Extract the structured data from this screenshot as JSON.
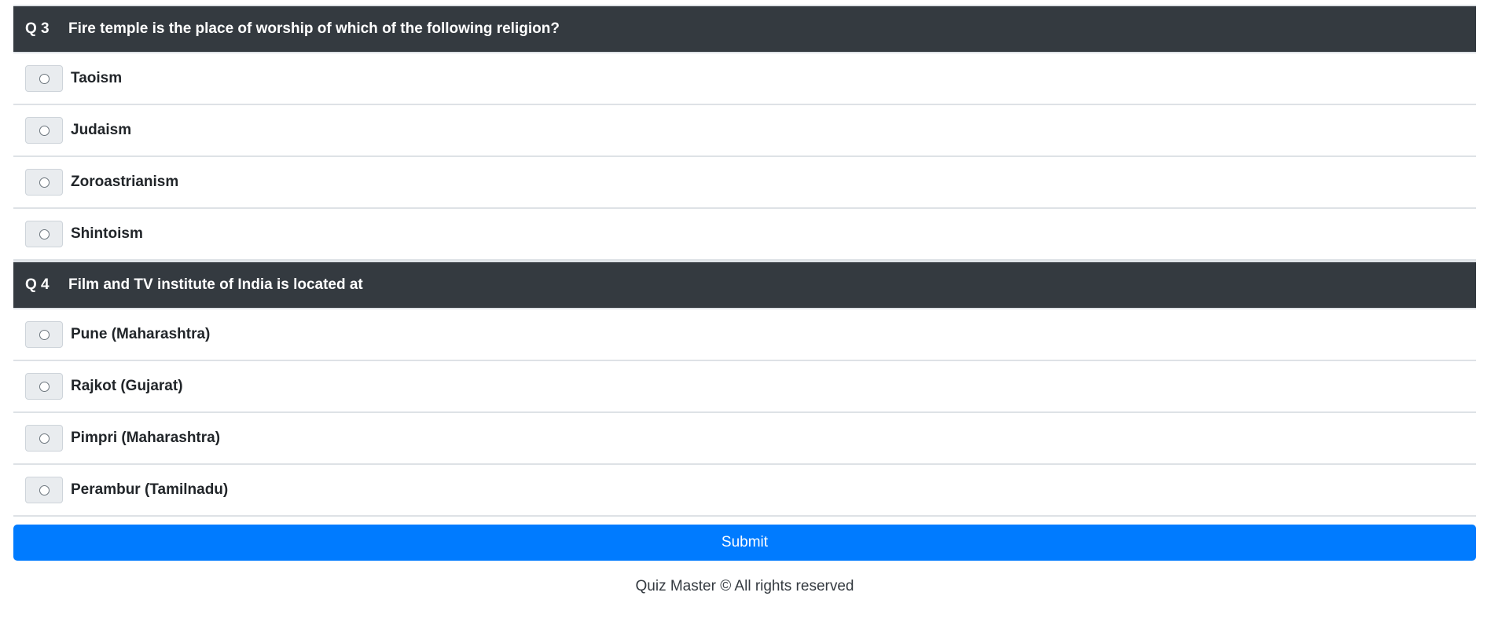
{
  "questions": [
    {
      "number": "Q 3",
      "text": "Fire temple is the place of worship of which of the following religion?",
      "options": [
        "Taoism",
        "Judaism",
        "Zoroastrianism",
        "Shintoism"
      ]
    },
    {
      "number": "Q 4",
      "text": "Film and TV institute of India is located at",
      "options": [
        "Pune (Maharashtra)",
        "Rajkot (Gujarat)",
        "Pimpri (Maharashtra)",
        "Perambur (Tamilnadu)"
      ]
    }
  ],
  "submit_label": "Submit",
  "footer_text": "Quiz Master © All rights reserved",
  "colors": {
    "header_bg": "#343a40",
    "accent": "#007bff"
  },
  "icons": {
    "option_marker": "radio-button-icon"
  }
}
